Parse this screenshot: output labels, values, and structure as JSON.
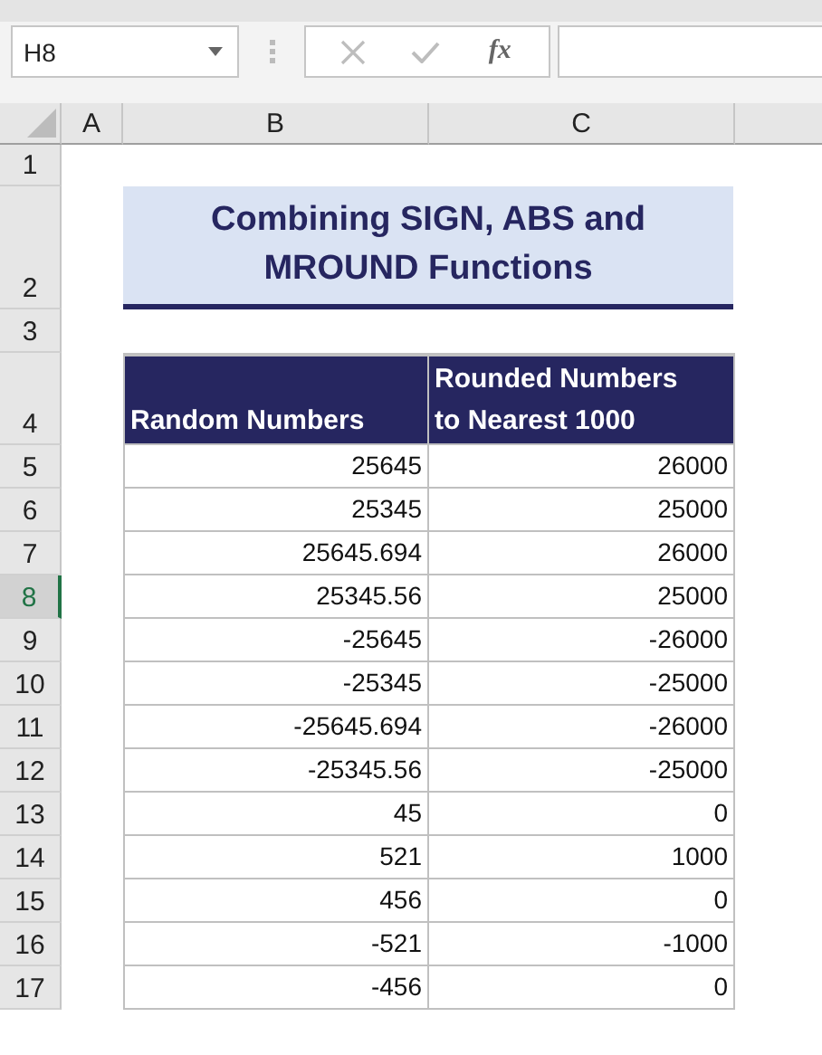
{
  "name_box": {
    "value": "H8"
  },
  "formula_bar": {
    "function_label": "fx"
  },
  "columns": [
    "A",
    "B",
    "C"
  ],
  "rows": [
    {
      "number": "1",
      "selected": false,
      "kind": "blank"
    },
    {
      "number": "2",
      "selected": false,
      "kind": "title",
      "text": "Combining SIGN, ABS and MROUND Functions"
    },
    {
      "number": "3",
      "selected": false,
      "kind": "blank"
    },
    {
      "number": "4",
      "selected": false,
      "kind": "header",
      "cells": [
        "Random Numbers",
        "Rounded Numbers to Nearest 1000"
      ]
    },
    {
      "number": "5",
      "selected": false,
      "kind": "data",
      "cells": [
        "25645",
        "26000"
      ]
    },
    {
      "number": "6",
      "selected": false,
      "kind": "data",
      "cells": [
        "25345",
        "25000"
      ]
    },
    {
      "number": "7",
      "selected": false,
      "kind": "data",
      "cells": [
        "25645.694",
        "26000"
      ]
    },
    {
      "number": "8",
      "selected": true,
      "kind": "data",
      "cells": [
        "25345.56",
        "25000"
      ]
    },
    {
      "number": "9",
      "selected": false,
      "kind": "data",
      "cells": [
        "-25645",
        "-26000"
      ]
    },
    {
      "number": "10",
      "selected": false,
      "kind": "data",
      "cells": [
        "-25345",
        "-25000"
      ]
    },
    {
      "number": "11",
      "selected": false,
      "kind": "data",
      "cells": [
        "-25645.694",
        "-26000"
      ]
    },
    {
      "number": "12",
      "selected": false,
      "kind": "data",
      "cells": [
        "-25345.56",
        "-25000"
      ]
    },
    {
      "number": "13",
      "selected": false,
      "kind": "data",
      "cells": [
        "45",
        "0"
      ]
    },
    {
      "number": "14",
      "selected": false,
      "kind": "data",
      "cells": [
        "521",
        "1000"
      ]
    },
    {
      "number": "15",
      "selected": false,
      "kind": "data",
      "cells": [
        "456",
        "0"
      ]
    },
    {
      "number": "16",
      "selected": false,
      "kind": "data",
      "cells": [
        "-521",
        "-1000"
      ]
    },
    {
      "number": "17",
      "selected": false,
      "kind": "data",
      "cells": [
        "-456",
        "0"
      ]
    }
  ]
}
